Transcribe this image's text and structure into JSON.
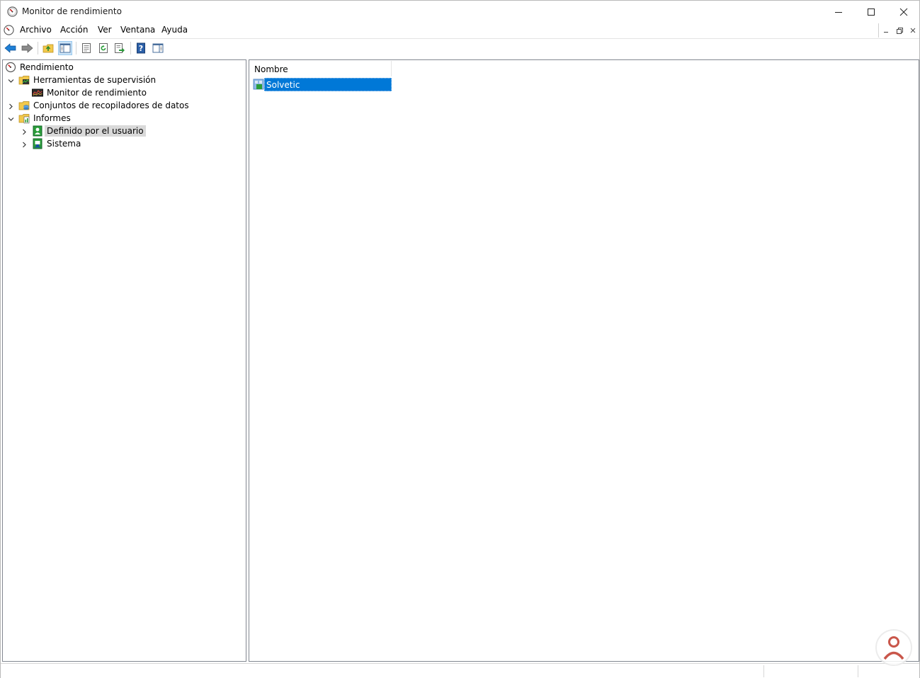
{
  "window": {
    "title": "Monitor de rendimiento"
  },
  "menu": {
    "items": [
      "Archivo",
      "Acción",
      "Ver",
      "Ventana",
      "Ayuda"
    ]
  },
  "toolbar": {
    "icons": [
      "back-arrow-icon",
      "forward-arrow-icon",
      "up-folder-icon",
      "show-hide-tree-icon",
      "properties-icon",
      "refresh-icon",
      "export-list-icon",
      "help-icon",
      "show-hide-action-pane-icon"
    ]
  },
  "tree": {
    "root": "Rendimiento",
    "monitoring_tools": "Herramientas de supervisión",
    "perf_monitor": "Monitor de rendimiento",
    "data_collector_sets": "Conjuntos de recopiladores de datos",
    "reports": "Informes",
    "user_defined": "Definido por el usuario",
    "system": "Sistema"
  },
  "list": {
    "column_name": "Nombre",
    "rows": [
      {
        "name": "Solvetic",
        "selected": true
      }
    ]
  },
  "colors": {
    "selection": "#0078d7",
    "tree_selection": "#d9d9d9",
    "pane_border": "#828790"
  }
}
